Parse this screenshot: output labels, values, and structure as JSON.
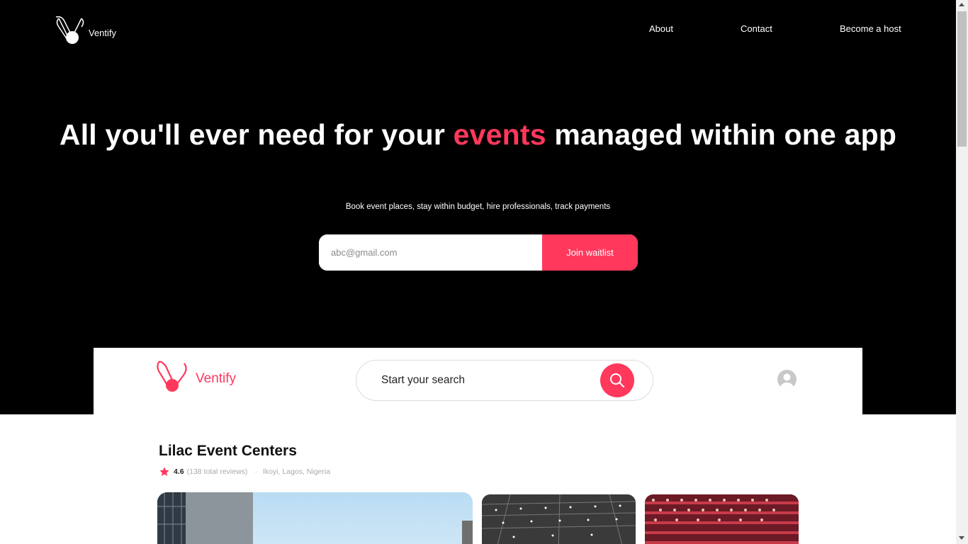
{
  "brand": {
    "name": "Ventify",
    "accent_color": "#ff385c",
    "logo_icon": "ventify-logo-icon"
  },
  "nav": {
    "items": [
      "About",
      "Contact",
      "Become a host"
    ]
  },
  "hero": {
    "headline_pre": "All you'll ever need for your ",
    "headline_accent": "events",
    "headline_post": " managed within one app",
    "subheadline": "Book event places, stay within budget, hire professionals, track payments",
    "email_placeholder": "abc@gmail.com",
    "cta_label": "Join waitlist"
  },
  "preview": {
    "brand_name": "Ventify",
    "search_label": "Start your search",
    "search_icon": "search-icon",
    "avatar_icon": "user-avatar-icon"
  },
  "listing": {
    "title": "Lilac Event Centers",
    "rating": "4.6",
    "reviews": "(138 total reviews)",
    "separator": "·",
    "location": "Ikoyi, Lagos, Nigeria",
    "rating_icon": "star-icon"
  }
}
